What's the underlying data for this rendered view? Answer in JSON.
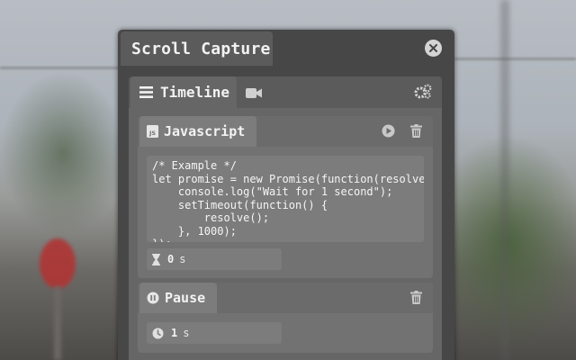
{
  "window": {
    "title": "Scroll Capture"
  },
  "tabs": {
    "active_label": "Timeline",
    "video_icon": "video-camera-icon",
    "settings_icon": "gear-icon"
  },
  "steps": [
    {
      "type_icon": "js-file-icon",
      "label": "Javascript",
      "code": "/* Example */\nlet promise = new Promise(function(resolve, reject) {\n    console.log(\"Wait for 1 second\");\n    setTimeout(function() {\n        resolve();\n    }, 1000);\n});",
      "timer_icon": "hourglass-icon",
      "duration_value": "0",
      "duration_unit": "s",
      "actions": [
        "play-icon",
        "trash-icon"
      ]
    },
    {
      "type_icon": "pause-icon",
      "label": "Pause",
      "timer_icon": "clock-icon",
      "duration_value": "1",
      "duration_unit": "s",
      "actions": [
        "trash-icon"
      ]
    }
  ],
  "colors": {
    "panel": "#474747",
    "tab_active": "#666666",
    "card": "#727272"
  }
}
